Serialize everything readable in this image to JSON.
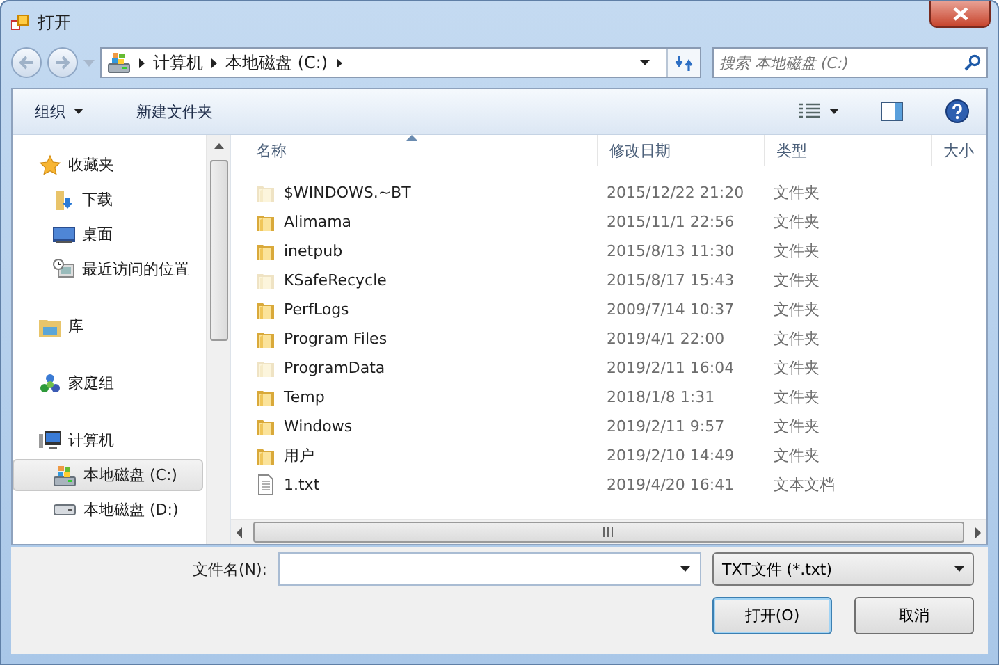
{
  "window": {
    "title": "打开"
  },
  "address": {
    "crumbs": [
      "计算机",
      "本地磁盘 (C:)"
    ]
  },
  "search": {
    "placeholder": "搜索 本地磁盘 (C:)"
  },
  "toolbar": {
    "organize": "组织",
    "new_folder": "新建文件夹"
  },
  "sidebar": {
    "items": [
      {
        "label": "收藏夹",
        "kind": "star",
        "selected": false,
        "children": [
          {
            "label": "下载",
            "kind": "download",
            "selected": false
          },
          {
            "label": "桌面",
            "kind": "desktop",
            "selected": false
          },
          {
            "label": "最近访问的位置",
            "kind": "recent",
            "selected": false
          }
        ]
      },
      {
        "label": "库",
        "kind": "library",
        "selected": false
      },
      {
        "label": "家庭组",
        "kind": "homegroup",
        "selected": false
      },
      {
        "label": "计算机",
        "kind": "computer",
        "selected": false,
        "children": [
          {
            "label": "本地磁盘 (C:)",
            "kind": "sysdrive",
            "selected": true
          },
          {
            "label": "本地磁盘 (D:)",
            "kind": "drive",
            "selected": false
          }
        ]
      }
    ]
  },
  "table": {
    "columns": [
      "名称",
      "修改日期",
      "类型",
      "大小"
    ],
    "rows": [
      {
        "kind": "folder",
        "hidden": true,
        "name": "$WINDOWS.~BT",
        "date": "2015/12/22 21:20",
        "type": "文件夹"
      },
      {
        "kind": "folder",
        "hidden": false,
        "name": "Alimama",
        "date": "2015/11/1 22:56",
        "type": "文件夹"
      },
      {
        "kind": "folder",
        "hidden": false,
        "name": "inetpub",
        "date": "2015/8/13 11:30",
        "type": "文件夹"
      },
      {
        "kind": "folder",
        "hidden": true,
        "name": "KSafeRecycle",
        "date": "2015/8/17 15:43",
        "type": "文件夹"
      },
      {
        "kind": "folder",
        "hidden": false,
        "name": "PerfLogs",
        "date": "2009/7/14 10:37",
        "type": "文件夹"
      },
      {
        "kind": "folder",
        "hidden": false,
        "name": "Program Files",
        "date": "2019/4/1 22:00",
        "type": "文件夹"
      },
      {
        "kind": "folder",
        "hidden": true,
        "name": "ProgramData",
        "date": "2019/2/11 16:04",
        "type": "文件夹"
      },
      {
        "kind": "folder",
        "hidden": false,
        "name": "Temp",
        "date": "2018/1/8 1:31",
        "type": "文件夹"
      },
      {
        "kind": "folder",
        "hidden": false,
        "name": "Windows",
        "date": "2019/2/11 9:57",
        "type": "文件夹"
      },
      {
        "kind": "folder",
        "hidden": false,
        "name": "用户",
        "date": "2019/2/10 14:49",
        "type": "文件夹"
      },
      {
        "kind": "file",
        "hidden": false,
        "name": "1.txt",
        "date": "2019/4/20 16:41",
        "type": "文本文档"
      }
    ]
  },
  "filename": {
    "label": "文件名(N):"
  },
  "filter": {
    "value": "TXT文件 (*.txt)"
  },
  "buttons": [
    {
      "label": "打开(O)",
      "default": true
    },
    {
      "label": "取消",
      "default": false
    }
  ]
}
